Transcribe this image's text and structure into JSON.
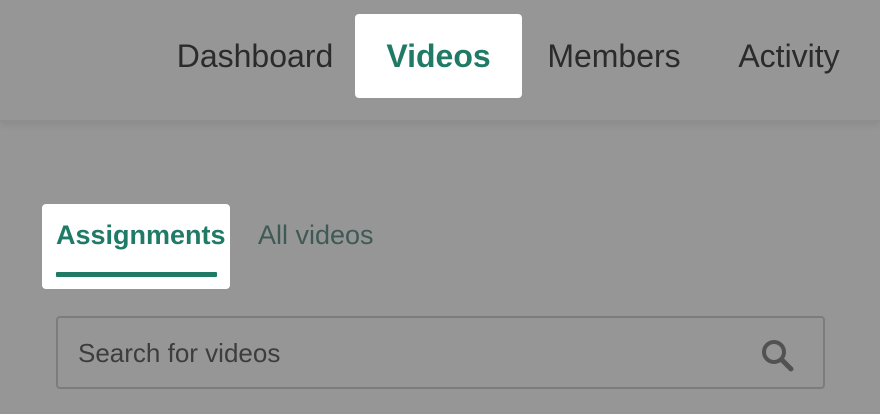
{
  "topnav": {
    "items": [
      {
        "label": "Dashboard",
        "active": false
      },
      {
        "label": "Videos",
        "active": true
      },
      {
        "label": "Members",
        "active": false
      },
      {
        "label": "Activity",
        "active": false
      }
    ]
  },
  "subtabs": {
    "items": [
      {
        "label": "Assignments",
        "active": true
      },
      {
        "label": "All videos",
        "active": false
      }
    ]
  },
  "search": {
    "placeholder": "Search for videos",
    "value": "",
    "icon": "search-icon"
  },
  "colors": {
    "accent": "#1f7a66",
    "overlay_background": "#969696",
    "highlight": "#ffffff"
  }
}
